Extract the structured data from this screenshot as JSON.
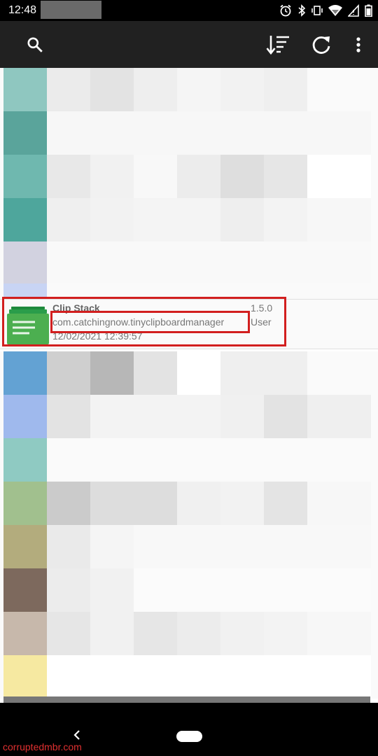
{
  "status_bar": {
    "time": "12:48",
    "icons": [
      "alarm-icon",
      "bluetooth-icon",
      "vibrate-icon",
      "wifi-icon",
      "signal-icon",
      "battery-icon"
    ]
  },
  "app_bar": {
    "icons": [
      "search-icon",
      "sort-icon",
      "refresh-icon",
      "more-vert-icon"
    ]
  },
  "highlighted_app": {
    "name": "Clip Stack",
    "package": "com.catchingnow.tinyclipboardmanager",
    "date": "12/02/2021 12:39:57",
    "version": "1.5.0",
    "type": "User",
    "icon": "clip-stack-app-icon",
    "highlight_color": "#d21f1f"
  },
  "list_colors": {
    "rows": [
      {
        "icon": "#8fc7c0",
        "cells": [
          "#ebebeb",
          "#e3e3e3",
          "#eeeeee",
          "#f5f5f5",
          "#f2f2f2",
          "#efefef",
          "#fafafa"
        ]
      },
      {
        "icon": "#5aa49b",
        "cells": [
          "#f7f7f7",
          "#f7f7f7",
          "#f7f7f7",
          "#f7f7f7",
          "#f7f7f7",
          "#f7f7f7",
          "#f7f7f7"
        ]
      },
      {
        "icon": "#6fb8af",
        "cells": [
          "#e8e8e8",
          "#f1f1f1",
          "#f8f8f8",
          "#ececec",
          "#dedede",
          "#e6e6e6",
          "#ffffff"
        ]
      },
      {
        "icon": "#4ea69c",
        "cells": [
          "#efefef",
          "#f2f2f2",
          "#f4f4f4",
          "#f4f4f4",
          "#eeeeee",
          "#f3f3f3",
          "#f7f7f7"
        ]
      },
      {
        "icon": "#d2d2e0",
        "cells": [
          "#f9f9f9",
          "#f9f9f9",
          "#f9f9f9",
          "#f9f9f9",
          "#f9f9f9",
          "#f9f9f9",
          "#f9f9f9"
        ]
      }
    ],
    "rows_below": [
      {
        "icon": "#63a2d3",
        "cells": [
          "#cfcfcf",
          "#b7b7b7",
          "#e3e3e3",
          "#ffffff",
          "#efefef",
          "#efefef",
          "#fafafa"
        ]
      },
      {
        "icon": "#9fb9ed",
        "cells": [
          "#e3e3e3",
          "#f3f3f3",
          "#f3f3f3",
          "#f3f3f3",
          "#f0f0f0",
          "#e3e3e3",
          "#efefef"
        ]
      },
      {
        "icon": "#8fcac2",
        "cells": [
          "#fafafa",
          "#fafafa",
          "#fafafa",
          "#fafafa",
          "#fafafa",
          "#fafafa",
          "#fafafa"
        ]
      },
      {
        "icon": "#a1c08e",
        "cells": [
          "#cbcbcb",
          "#dddddd",
          "#dddddd",
          "#f0f0f0",
          "#f2f2f2",
          "#e4e4e4",
          "#f7f7f7"
        ]
      },
      {
        "icon": "#b3ac7d",
        "cells": [
          "#eaeaea",
          "#f5f5f5",
          "#f8f8f8",
          "#f8f8f8",
          "#f8f8f8",
          "#f8f8f8",
          "#f8f8f8"
        ]
      },
      {
        "icon": "#7d695d",
        "cells": [
          "#ececec",
          "#f1f1f1",
          "#fbfbfb",
          "#fbfbfb",
          "#fbfbfb",
          "#fbfbfb",
          "#fbfbfb"
        ]
      },
      {
        "icon": "#c7b8ab",
        "cells": [
          "#e6e6e6",
          "#f1f1f1",
          "#e6e6e6",
          "#ececec",
          "#f1f1f1",
          "#f3f3f3",
          "#f7f7f7"
        ]
      },
      {
        "icon": "#f6e9a1",
        "cells": [
          "#ffffff",
          "#ffffff",
          "#ffffff",
          "#ffffff",
          "#ffffff",
          "#ffffff",
          "#ffffff"
        ]
      }
    ]
  },
  "watermark": "corruptedmbr.com",
  "nav_bar": {
    "icons": [
      "back-icon",
      "home-pill-icon"
    ]
  }
}
